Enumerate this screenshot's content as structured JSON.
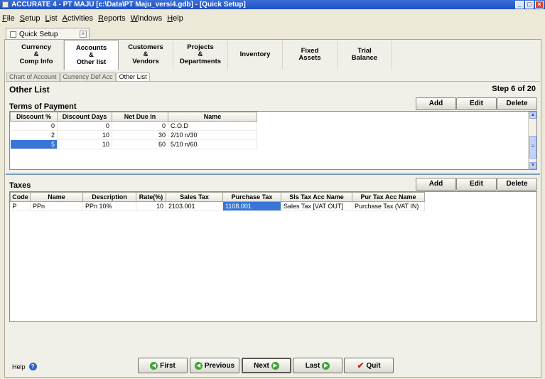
{
  "window": {
    "title": "ACCURATE 4  - PT MAJU   [c:\\Data\\PT Maju_versi4.gdb] - [Quick Setup]"
  },
  "menu": [
    "File",
    "Setup",
    "List",
    "Activities",
    "Reports",
    "Windows",
    "Help"
  ],
  "doc_tab": {
    "label": "Quick Setup"
  },
  "steps": [
    "Currency\n&\nComp Info",
    "Accounts\n&\nOther list",
    "Customers\n&\nVendors",
    "Projects\n&\nDepartments",
    "Inventory",
    "Fixed\nAssets",
    "Trial\nBalance"
  ],
  "subtabs": [
    "Chart of Account",
    "Currency Def Acc",
    "Other List"
  ],
  "page": {
    "title": "Other List",
    "step": "Step 6 of 20"
  },
  "buttons": {
    "add": "Add",
    "edit": "Edit",
    "delete": "Delete"
  },
  "terms": {
    "title": "Terms of Payment",
    "columns": [
      "Discount %",
      "Discount Days",
      "Net Due In",
      "Name"
    ],
    "rows": [
      [
        "0",
        "0",
        "0",
        "C.O.D"
      ],
      [
        "2",
        "10",
        "30",
        "2/10 n/30"
      ],
      [
        "5",
        "10",
        "60",
        "5/10 n/60"
      ]
    ]
  },
  "taxes": {
    "title": "Taxes",
    "columns": [
      "Code",
      "Name",
      "Description",
      "Rate(%)",
      "Sales Tax",
      "Purchase Tax",
      "Sls Tax Acc Name",
      "Pur Tax Acc Name"
    ],
    "rows": [
      [
        "P",
        "PPn",
        "PPn 10%",
        "10",
        "2103.001",
        "1108.001",
        "Sales Tax [VAT OUT]",
        "Purchase Tax (VAT IN)"
      ]
    ]
  },
  "footer": {
    "help": "Help",
    "first": "First",
    "previous": "Previous",
    "next": "Next",
    "last": "Last",
    "quit": "Quit"
  }
}
